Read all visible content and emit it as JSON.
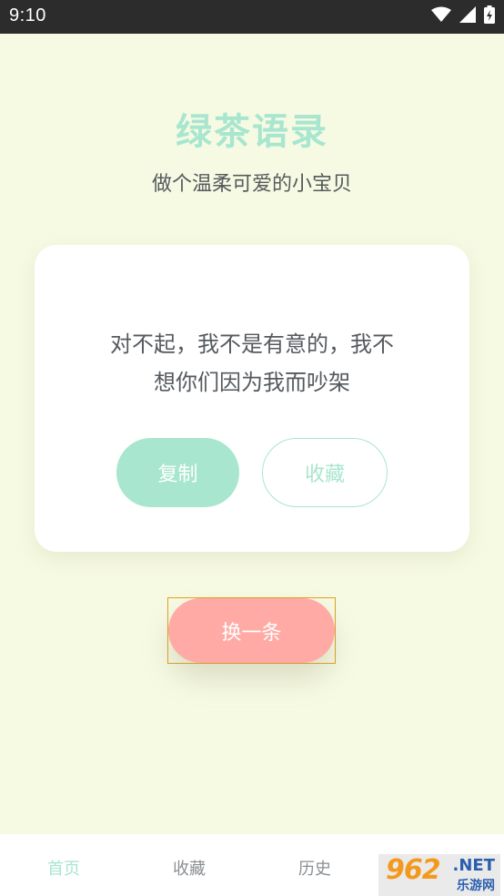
{
  "status_bar": {
    "time": "9:10",
    "icons": [
      "wifi-icon",
      "signal-icon",
      "battery-icon"
    ]
  },
  "header": {
    "title": "绿茶语录",
    "subtitle": "做个温柔可爱的小宝贝"
  },
  "quote": {
    "line1": "对不起，我不是有意的，我不",
    "line2": "想你们因为我而吵架"
  },
  "actions": {
    "copy_label": "复制",
    "favorite_label": "收藏",
    "next_label": "换一条"
  },
  "nav": {
    "items": [
      {
        "label": "首页",
        "active": true
      },
      {
        "label": "收藏",
        "active": false
      },
      {
        "label": "历史",
        "active": false
      }
    ]
  },
  "watermark": {
    "main": "962",
    "net": ".NET",
    "sub": "乐游网"
  },
  "colors": {
    "background": "#f7fae3",
    "accent_green": "#a8e6cf",
    "accent_pink": "#ffaaa5",
    "text_gray": "#555a5e"
  }
}
